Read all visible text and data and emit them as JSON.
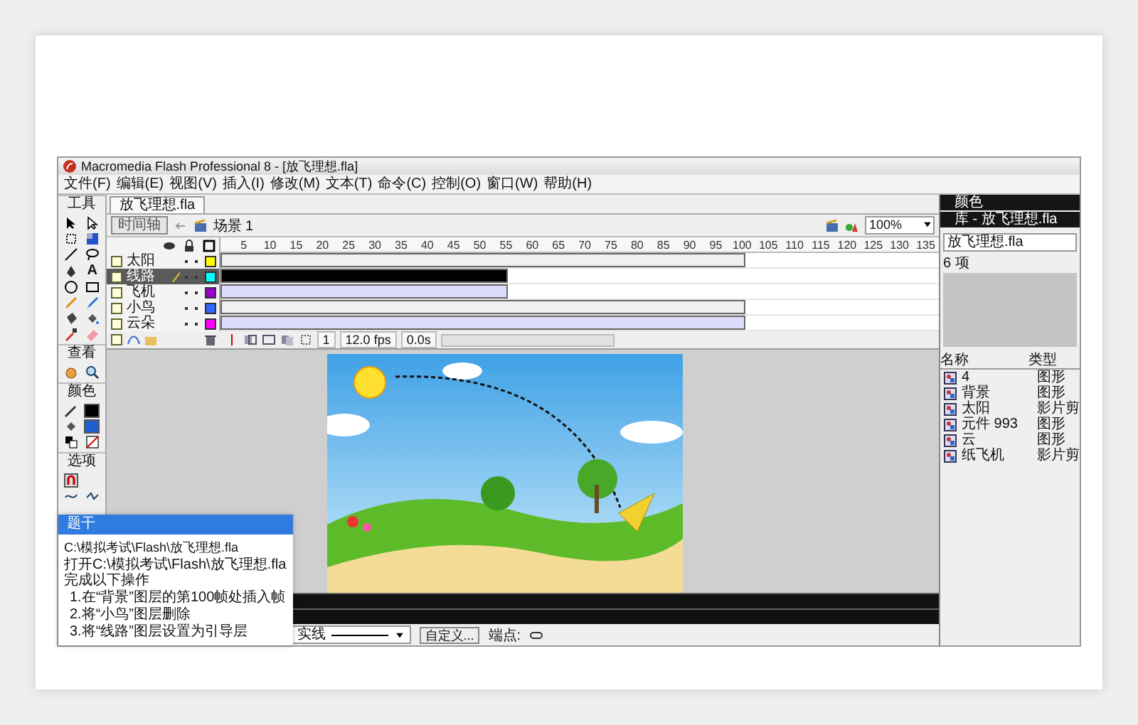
{
  "title_bar": {
    "title": "Macromedia Flash Professional 8 - [放飞理想.fla]"
  },
  "menu": [
    "文件(F)",
    "编辑(E)",
    "视图(V)",
    "插入(I)",
    "修改(M)",
    "文本(T)",
    "命令(C)",
    "控制(O)",
    "窗口(W)",
    "帮助(H)"
  ],
  "toolbox": {
    "title": "工具",
    "text_tool": "A",
    "sections": [
      "查看",
      "颜色",
      "选项"
    ]
  },
  "document": {
    "tab": "放飞理想.fla",
    "timeline_button": "时间轴",
    "scene": "场景 1",
    "zoom": "100%"
  },
  "timeline": {
    "ruler": [
      "5",
      "10",
      "15",
      "20",
      "25",
      "30",
      "35",
      "40",
      "45",
      "50",
      "55",
      "60",
      "65",
      "70",
      "75",
      "80",
      "85",
      "90",
      "95",
      "100",
      "105",
      "110",
      "115",
      "120",
      "125",
      "130",
      "135"
    ],
    "layers": [
      {
        "name": "太阳",
        "selected": false,
        "color": "#ffff00",
        "kind": "static",
        "level": 0.73
      },
      {
        "name": "线路",
        "selected": true,
        "color": "#00ffff",
        "kind": "static",
        "level": 0.4
      },
      {
        "name": "飞机",
        "selected": false,
        "color": "#9900cc",
        "kind": "tween",
        "level": 0.4
      },
      {
        "name": "小鸟",
        "selected": false,
        "color": "#3366ff",
        "kind": "static",
        "level": 0.73
      },
      {
        "name": "云朵",
        "selected": false,
        "color": "#ff00ff",
        "kind": "tween",
        "level": 0.73
      }
    ],
    "current_frame": "1",
    "fps": "12.0 fps",
    "time": "0.0s"
  },
  "properties": {
    "stroke_style": "实线",
    "custom_button": "自定义...",
    "cap_label": "端点:"
  },
  "library": {
    "color_panel": "颜色",
    "title": "库 - 放飞理想.fla",
    "document": "放飞理想.fla",
    "count": "6 项",
    "columns": [
      "名称",
      "类型"
    ],
    "items": [
      {
        "name": "4",
        "type": "图形"
      },
      {
        "name": "背景",
        "type": "图形"
      },
      {
        "name": "太阳",
        "type": "影片剪"
      },
      {
        "name": "元件 993",
        "type": "图形"
      },
      {
        "name": "云",
        "type": "图形"
      },
      {
        "name": "纸飞机",
        "type": "影片剪"
      }
    ]
  },
  "task": {
    "title": "题干",
    "path": "C:\\模拟考试\\Flash\\放飞理想.fla",
    "lines": [
      "打开C:\\模拟考试\\Flash\\放飞理想.fla完成以下操作",
      "1.在“背景”图层的第100帧处插入帧",
      "2.将“小鸟”图层删除",
      "3.将“线路”图层设置为引导层"
    ]
  }
}
